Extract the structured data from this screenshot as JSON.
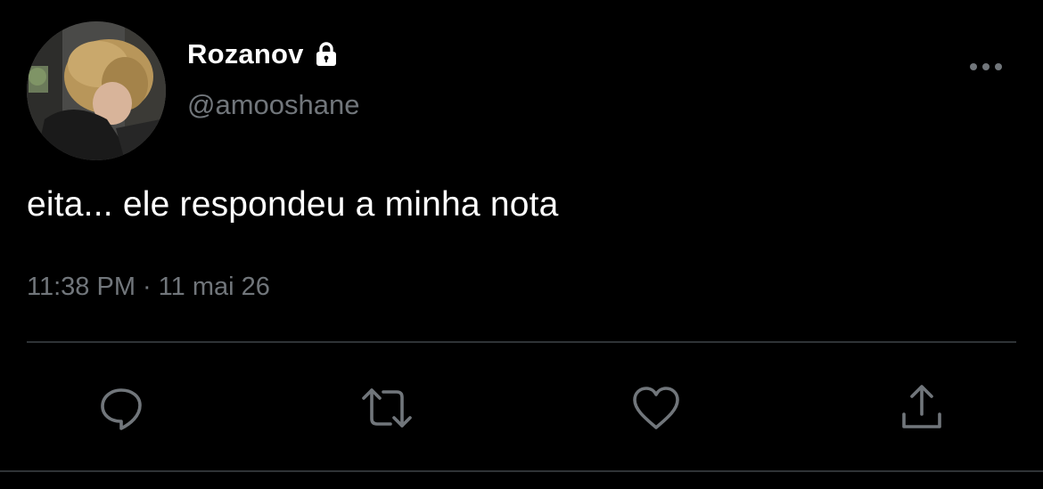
{
  "user": {
    "display_name": "Rozanov",
    "handle": "@amooshane",
    "locked": true
  },
  "tweet": {
    "text": "eita... ele respondeu a minha nota",
    "time": "11:38 PM",
    "separator": "·",
    "date": "11 mai 26"
  },
  "icons": {
    "lock": "lock-icon",
    "more": "more-horizontal-icon",
    "reply": "reply-icon",
    "retweet": "retweet-icon",
    "like": "like-icon",
    "share": "share-icon"
  },
  "colors": {
    "background": "#000000",
    "primary_text": "#ffffff",
    "secondary_text": "#71767b",
    "divider": "#2f3336"
  }
}
